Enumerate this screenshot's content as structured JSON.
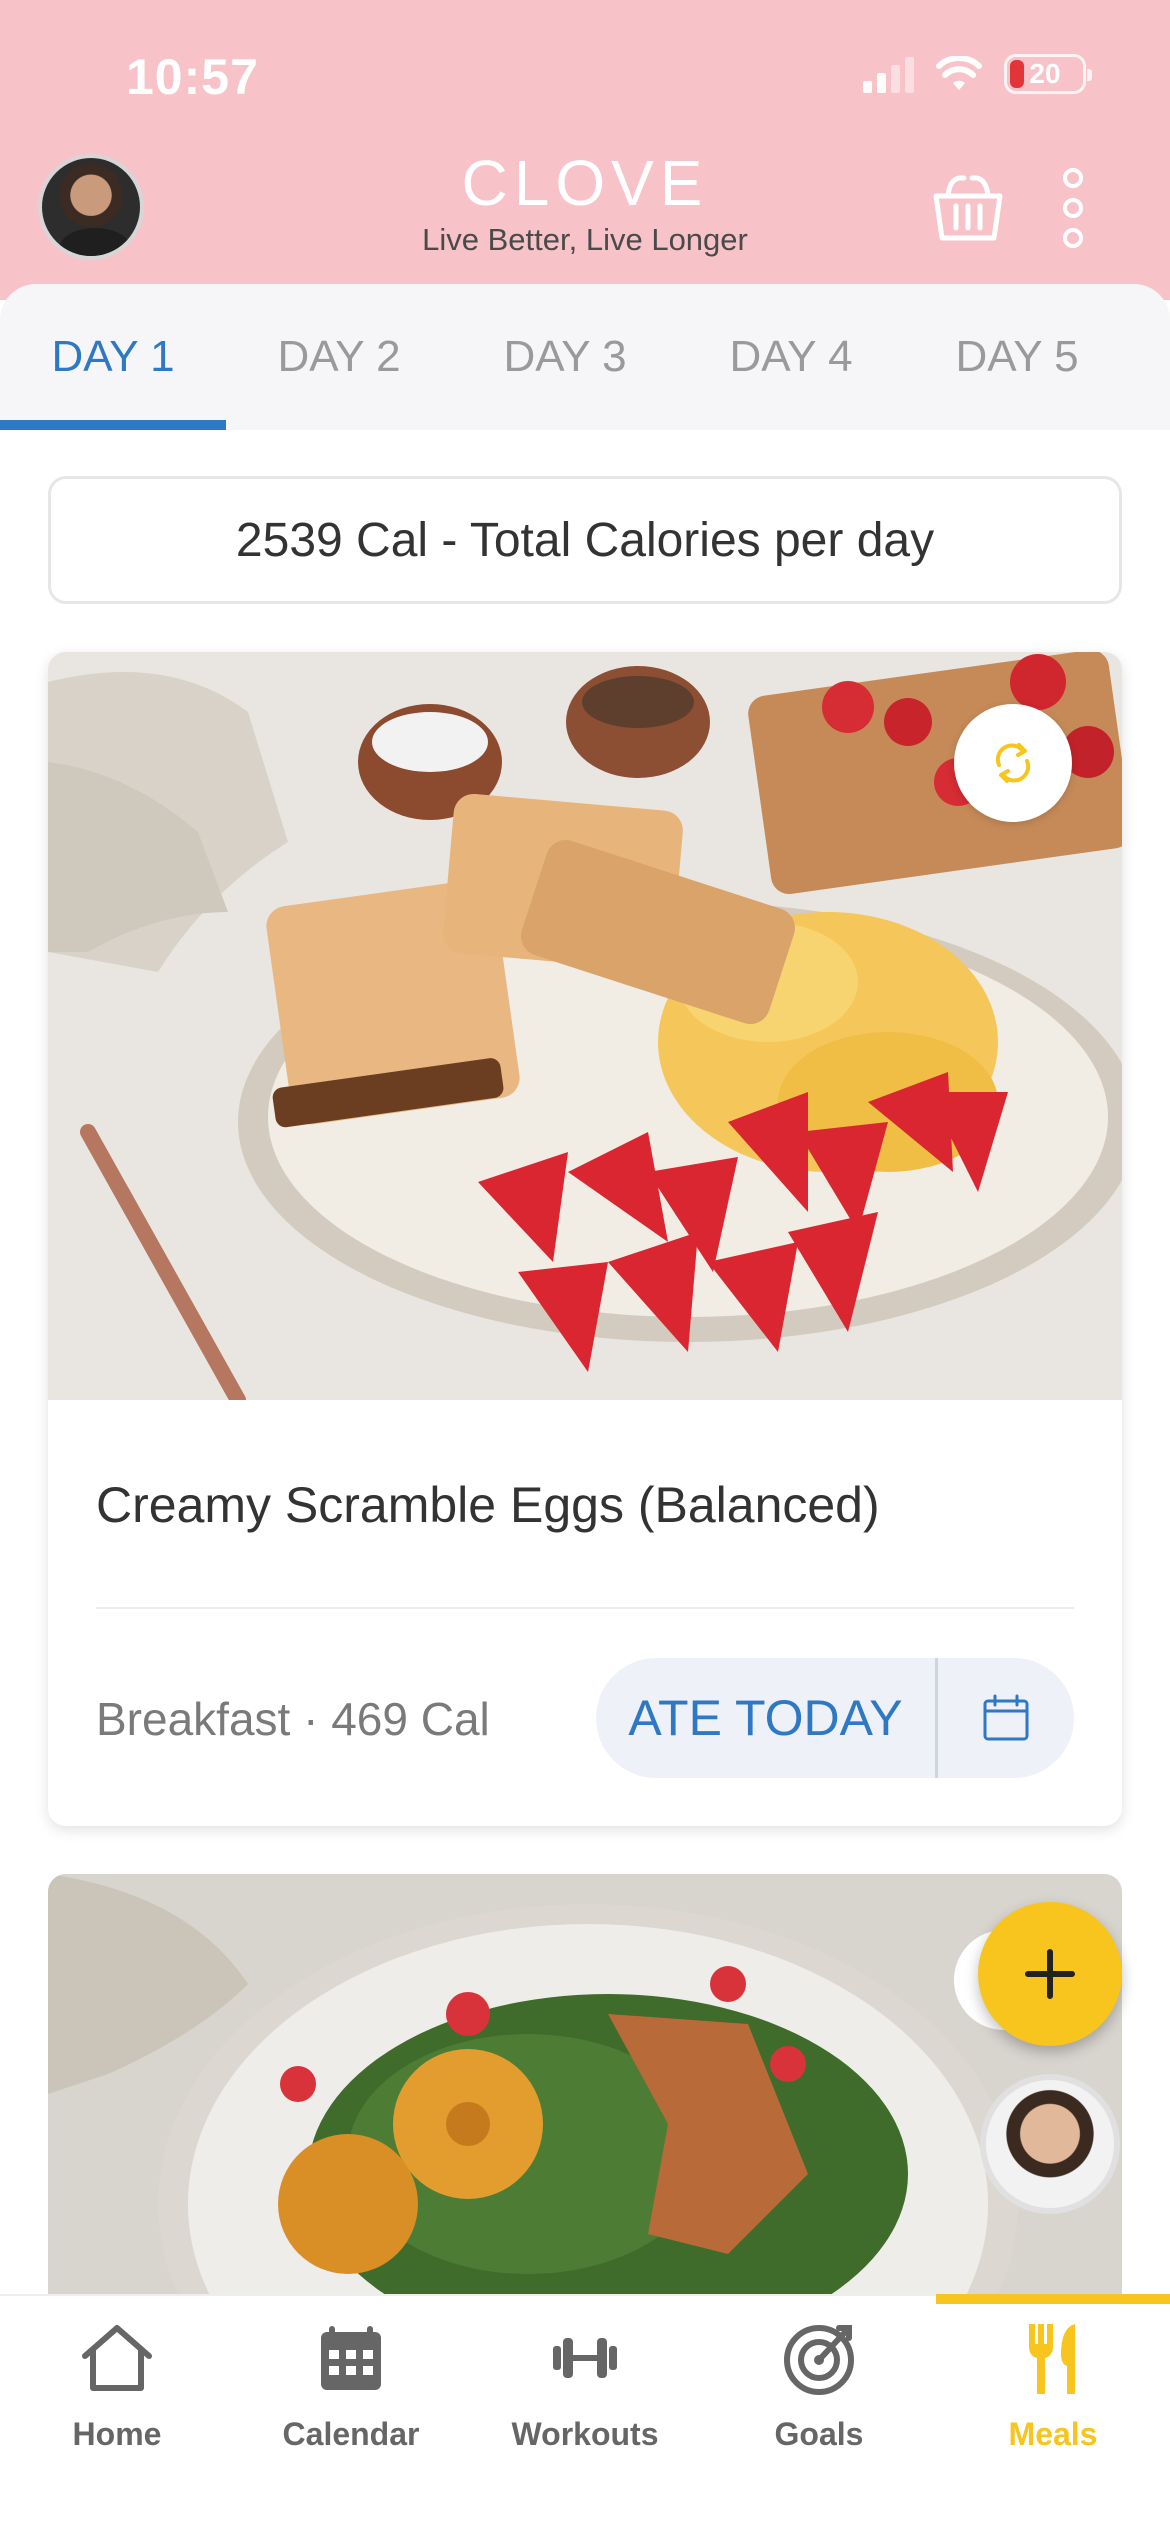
{
  "status_bar": {
    "time": "10:57",
    "battery": "20"
  },
  "header": {
    "logo": "CLOVE",
    "tagline": "Live Better, Live Longer",
    "icons": [
      "avatar",
      "shopping-basket-icon",
      "more-vertical-icon"
    ]
  },
  "tabs": [
    {
      "label": "DAY 1",
      "active": true
    },
    {
      "label": "DAY 2",
      "active": false
    },
    {
      "label": "DAY 3",
      "active": false
    },
    {
      "label": "DAY 4",
      "active": false
    },
    {
      "label": "DAY 5",
      "active": false
    }
  ],
  "calories_summary": "2539 Cal - Total Calories per day",
  "meals": [
    {
      "title": "Creamy Scramble Eggs (Balanced)",
      "meta": "Breakfast · 469 Cal",
      "action_label": "ATE TODAY"
    }
  ],
  "bottom_nav": [
    {
      "label": "Home",
      "icon": "home-icon",
      "active": false
    },
    {
      "label": "Calendar",
      "icon": "calendar-icon",
      "active": false
    },
    {
      "label": "Workouts",
      "icon": "dumbbell-icon",
      "active": false
    },
    {
      "label": "Goals",
      "icon": "target-icon",
      "active": false
    },
    {
      "label": "Meals",
      "icon": "utensils-icon",
      "active": true
    }
  ],
  "colors": {
    "header_bg": "#f7c3c9",
    "accent_blue": "#2f78c4",
    "accent_yellow": "#f7c51e"
  }
}
